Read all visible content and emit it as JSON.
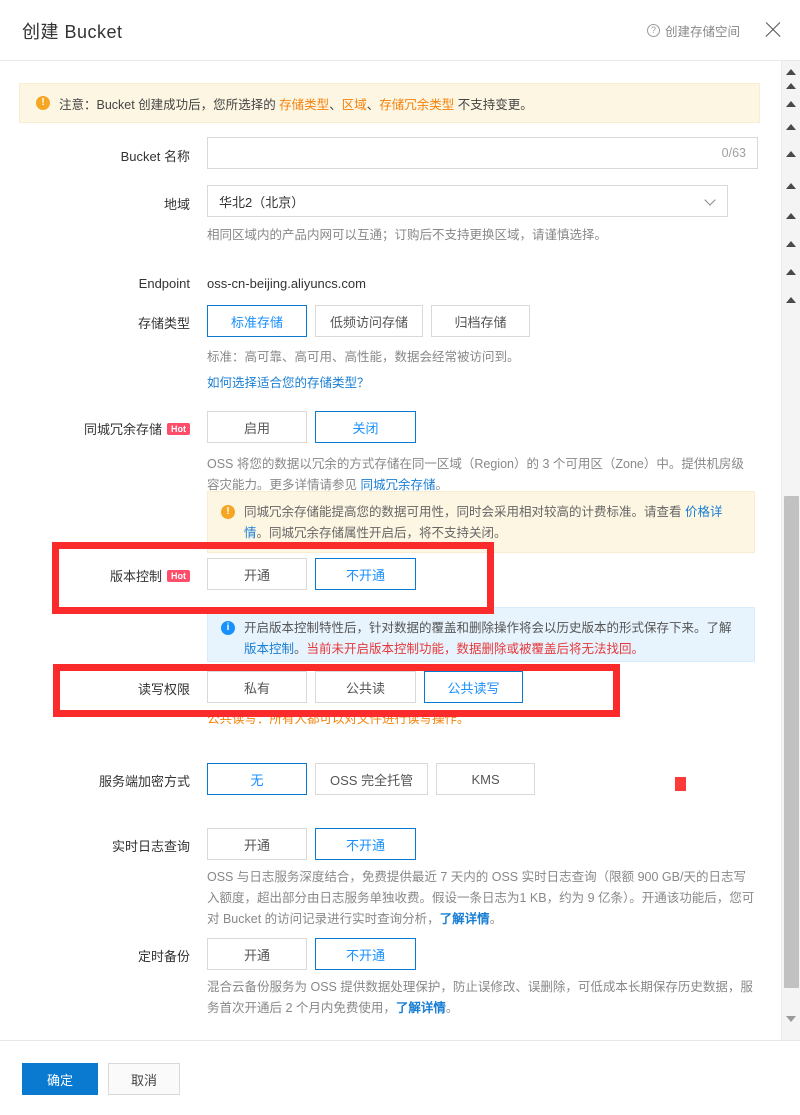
{
  "header": {
    "title": "创建 Bucket",
    "help_label": "创建存储空间",
    "help_icon": "question-circle-icon",
    "close_icon": "close-icon"
  },
  "notice": {
    "icon": "warning-icon",
    "prefix": "注意：Bucket 创建成功后，您所选择的 ",
    "em1": "存储类型",
    "sep1": "、",
    "em2": "区域",
    "sep2": "、",
    "em3": "存储冗余类型",
    "suffix": " 不支持变更。"
  },
  "fields": {
    "bucket_name": {
      "label": "Bucket 名称",
      "value": "",
      "placeholder": "",
      "counter": "0/63"
    },
    "region": {
      "label": "地域",
      "value": "华北2（北京）",
      "desc": "相同区域内的产品内网可以互通；订购后不支持更换区域，请谨慎选择。",
      "chevron_icon": "chevron-down-icon"
    },
    "endpoint": {
      "label": "Endpoint",
      "value": "oss-cn-beijing.aliyuncs.com"
    },
    "storage_class": {
      "label": "存储类型",
      "options": [
        "标准存储",
        "低频访问存储",
        "归档存储"
      ],
      "selected": 0,
      "desc": "标准：高可靠、高可用、高性能，数据会经常被访问到。",
      "link": "如何选择适合您的存储类型？"
    },
    "zone_redundancy": {
      "label": "同城冗余存储",
      "badge": "Hot",
      "options": [
        "启用",
        "关闭"
      ],
      "selected": 1,
      "desc_part1": "OSS 将您的数据以冗余的方式存储在同一区域（Region）的 3 个可用区（Zone）中。提供机房级容灾能力。更多详情请参见 ",
      "desc_link": "同城冗余存储",
      "desc_part2": "。",
      "info": {
        "icon": "warning-icon",
        "text1": "同城冗余存储能提高您的数据可用性，同时会采用相对较高的计费标准。请查看 ",
        "link": "价格详情",
        "text2": "。同城冗余存储属性开启后，将不支持关闭。"
      }
    },
    "versioning": {
      "label": "版本控制",
      "badge": "Hot",
      "options": [
        "开通",
        "不开通"
      ],
      "selected": 1,
      "info": {
        "icon": "info-icon",
        "text1": "开启版本控制特性后，针对数据的覆盖和删除操作将会以历史版本的形式保存下来。了解 ",
        "link": "版本控制",
        "text2": "。",
        "warn": "当前未开启版本控制功能，数据删除或被覆盖后将无法找回。"
      }
    },
    "acl": {
      "label": "读写权限",
      "options": [
        "私有",
        "公共读",
        "公共读写"
      ],
      "selected": 2,
      "desc": "公共读写：所有人都可以对文件进行读写操作。"
    },
    "encryption": {
      "label": "服务端加密方式",
      "options": [
        "无",
        "OSS 完全托管",
        "KMS"
      ],
      "selected": 0
    },
    "realtime_log": {
      "label": "实时日志查询",
      "options": [
        "开通",
        "不开通"
      ],
      "selected": 1,
      "desc_part1": "OSS 与日志服务深度结合，免费提供最近 7 天内的 OSS 实时日志查询（限额 900 GB/天的日志写入额度，超出部分由日志服务单独收费。假设一条日志为1 KB，约为 9 亿条）。开通该功能后，您可对 Bucket 的访问记录进行实时查询分析，",
      "desc_link": "了解详情",
      "desc_part2": "。"
    },
    "scheduled_backup": {
      "label": "定时备份",
      "options": [
        "开通",
        "不开通"
      ],
      "selected": 1,
      "desc_part1": "混合云备份服务为 OSS 提供数据处理保护，防止误修改、误删除，可低成本长期保存历史数据，服务首次开通后 2 个月内免费使用，",
      "desc_link": "了解详情",
      "desc_part2": "。"
    }
  },
  "footer": {
    "confirm_label": "确定",
    "cancel_label": "取消"
  },
  "scrollbar": {
    "up_arrow_icon": "triangle-up-icon",
    "down_arrow_icon": "triangle-down-icon"
  },
  "annotations": {
    "box1_target": "版本控制",
    "box2_target": "读写权限",
    "marker": "red-square-marker"
  },
  "colors": {
    "accent": "#1890ff",
    "primary_button": "#0a7ad1",
    "warning_bg": "#fdf6e3",
    "info_bg": "#e8f4fd",
    "hot_badge": "#ff4d6a",
    "annotation_red": "#fc2b2b",
    "link": "#1a7fd4",
    "danger_text": "#e4393c",
    "orange_text": "#f5820b"
  }
}
